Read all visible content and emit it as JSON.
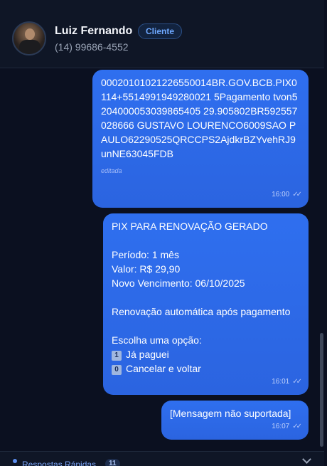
{
  "contact": {
    "name": "Luiz Fernando",
    "badge": "Cliente",
    "phone": "(14) 99686-4552"
  },
  "messages": [
    {
      "text": "00020101021226550014BR.GOV.BCB.PIX0114+5514991949280021 5Pagamento tvon5204000053039865405 29.905802BR592557028666 GUSTAVO LOURENCO6009SAO PAULO62290525QRCCPS2AjdkrBZYvehRJ9unNE63045FDB",
      "edited_label": "editada",
      "time": "16:00",
      "status": "read"
    },
    {
      "lines": [
        "PIX PARA RENOVAÇÃO GERADO",
        "",
        "Período: 1 mês",
        "Valor: R$ 29,90",
        "Novo Vencimento: 06/10/2025",
        "",
        "Renovação automática após pagamento",
        "",
        "Escolha uma opção:"
      ],
      "options": [
        {
          "key": "1",
          "label": "Já paguei"
        },
        {
          "key": "0",
          "label": "Cancelar e voltar"
        }
      ],
      "time": "16:01",
      "status": "read"
    },
    {
      "text": "[Mensagem não suportada]",
      "time": "16:07",
      "status": "read"
    }
  ],
  "quick_replies": {
    "label": "Respostas Rápidas",
    "count": "11"
  },
  "colors": {
    "bubble": "#2f6fef",
    "background": "#0b1020",
    "badge_text": "#6ea8ff"
  }
}
